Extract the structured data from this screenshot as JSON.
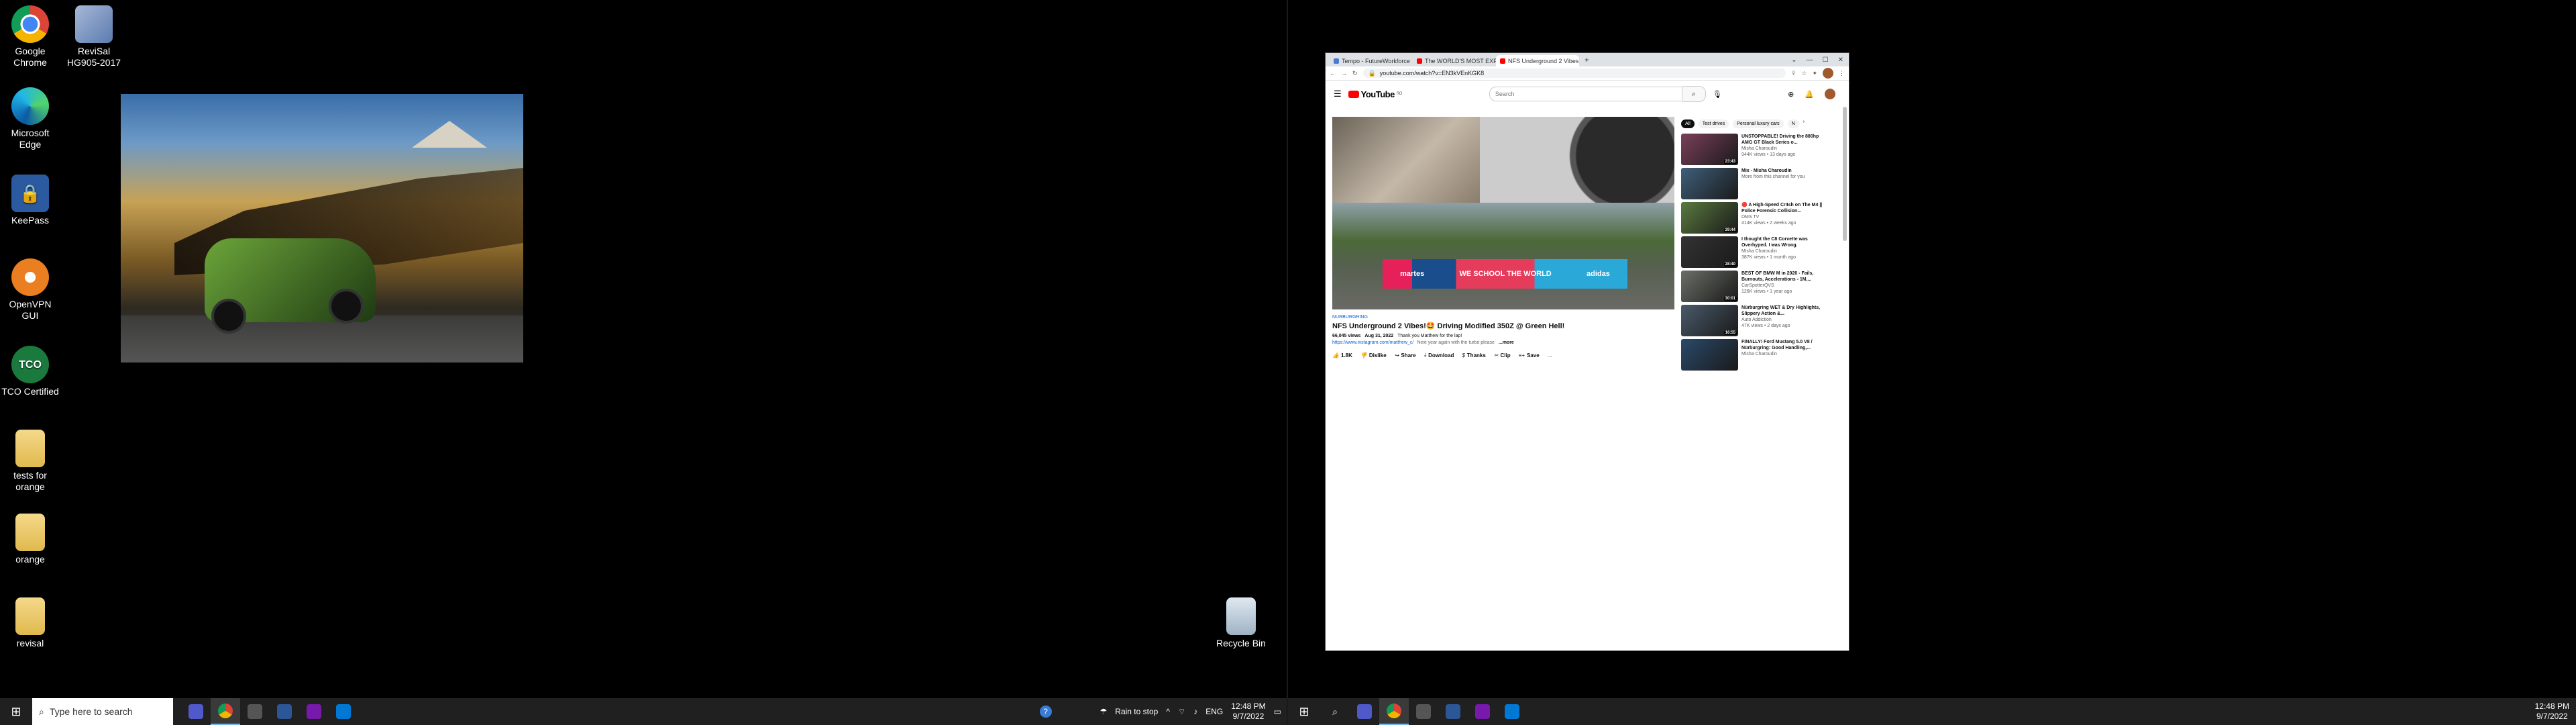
{
  "desktop_icons": [
    {
      "label": "Google Chrome",
      "icon": "chrome-icon"
    },
    {
      "label": "ReviSal HG905-2017",
      "icon": "revisal-shortcut-icon"
    },
    {
      "label": "Microsoft Edge",
      "icon": "edge-icon"
    },
    {
      "label": "KeePass",
      "icon": "keepass-icon"
    },
    {
      "label": "OpenVPN GUI",
      "icon": "openvpn-icon"
    },
    {
      "label": "TCO Certified",
      "icon": "tco-icon"
    },
    {
      "label": "tests for orange",
      "icon": "file-icon"
    },
    {
      "label": "orange",
      "icon": "file-icon"
    },
    {
      "label": "revisal",
      "icon": "file-icon"
    },
    {
      "label": "Recycle Bin",
      "icon": "recycle-bin-icon"
    }
  ],
  "left_taskbar": {
    "search_placeholder": "Type here to search",
    "weather": "Rain to stop",
    "language": "ENG",
    "time": "12:48 PM",
    "date": "9/7/2022"
  },
  "right_taskbar": {
    "time": "12:48 PM",
    "date": "9/7/2022"
  },
  "browser": {
    "tabs": [
      {
        "title": "Tempo - FutureWorkforce",
        "active": false
      },
      {
        "title": "The WORLD'S MOST EXPENSIVE",
        "active": false
      },
      {
        "title": "NFS Underground 2 Vibes!",
        "active": true
      }
    ],
    "new_tab": "+",
    "url": "youtube.com/watch?v=EN3kVEnKGK8"
  },
  "youtube": {
    "logo_text": "YouTube",
    "country": "RO",
    "search_placeholder": "Search",
    "ad_text_1": "WE SCHOOL THE WORLD",
    "ad_text_2": "adidas",
    "ad_brand": "martes",
    "video": {
      "tag": "NURBURGRING",
      "title": "NFS Underground 2 Vibes!🤩 Driving Modified 350Z @ Green Hell!",
      "views": "66,045 views",
      "date": "Aug 31, 2022",
      "thanks": "Thank you Matthew for the lap!",
      "link": "https://www.instagram.com/matthew_c/",
      "desc": "Next year again with the turbo please",
      "more": "...more"
    },
    "actions": {
      "like": "1.8K",
      "dislike": "Dislike",
      "share": "Share",
      "download": "Download",
      "thanks": "Thanks",
      "clip": "Clip",
      "save": "Save",
      "more": "..."
    },
    "chips": [
      "All",
      "Test drives",
      "Personal luxury cars",
      "N"
    ],
    "related": [
      {
        "title": "UNSTOPPABLE! Driving the 880hp AMG GT Black Series o...",
        "channel": "Misha Charoudin",
        "meta": "944K views • 13 days ago",
        "duration": "23:43",
        "color": "#7a3f5a"
      },
      {
        "title": "Mix - Misha Charoudin",
        "channel": "More from this channel for you",
        "meta": "",
        "duration": "",
        "color": "#3f5f7a"
      },
      {
        "title": "🔴 A High-Speed Cr4sh on The M4 || Police Forensic Collision...",
        "channel": "DMS TV",
        "meta": "414K views • 2 weeks ago",
        "duration": "29:44",
        "color": "#5a7a3f"
      },
      {
        "title": "I thought the C8 Corvette was Overhyped. I was Wrong.",
        "channel": "Misha Charoudin",
        "meta": "387K views • 1 month ago",
        "duration": "28:40",
        "color": "#333333"
      },
      {
        "title": "BEST OF BMW M in 2020 - Fails, Burnouts, Accelerations - 1M,...",
        "channel": "CarSpotterQVS",
        "meta": "126K views • 1 year ago",
        "duration": "30:01",
        "color": "#6a6f66"
      },
      {
        "title": "Nürburgring WET & Dry Highlights, Slippery Action &...",
        "channel": "Auto Addiction",
        "meta": "47K views • 2 days ago",
        "duration": "16:55",
        "color": "#4a5a6a"
      },
      {
        "title": "FINALLY! Ford Mustang 5.0 V8 / Nürburgring: Good Handling,...",
        "channel": "Misha Charoudin",
        "meta": "",
        "duration": "",
        "color": "#2a4a6a"
      }
    ]
  }
}
